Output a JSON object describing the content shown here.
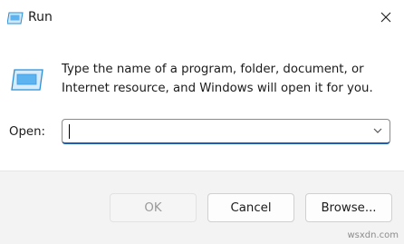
{
  "window": {
    "title": "Run",
    "app_icon": "run-icon"
  },
  "titlebar": {
    "close_icon": "close-icon"
  },
  "description": "Type the name of a program, folder, document, or Internet resource, and Windows will open it for you.",
  "open_field": {
    "label": "Open:",
    "value": ""
  },
  "buttons": {
    "ok": "OK",
    "cancel": "Cancel",
    "browse": "Browse..."
  },
  "watermark": "wsxdn.com",
  "colors": {
    "accent": "#1a5fb4",
    "icon_blue": "#5db3f0"
  }
}
